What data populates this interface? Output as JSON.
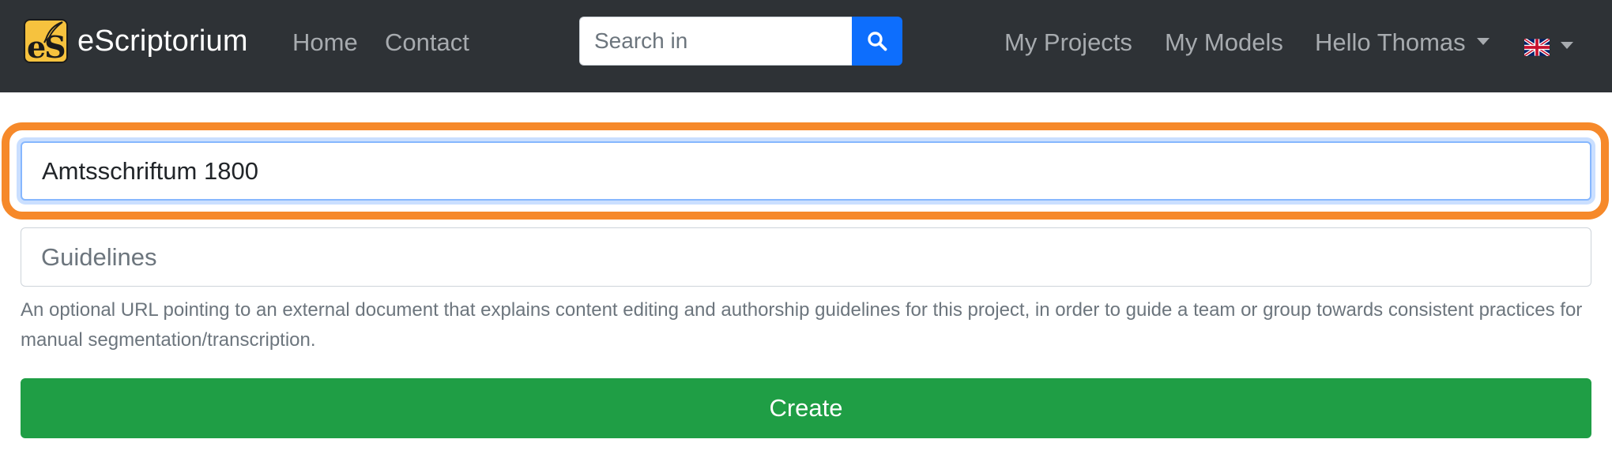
{
  "navbar": {
    "brand_logo_text": "eS",
    "brand_name": "eScriptorium",
    "links": {
      "home": "Home",
      "contact": "Contact",
      "my_projects": "My Projects",
      "my_models": "My Models",
      "user": "Hello Thomas"
    },
    "search": {
      "placeholder": "Search in",
      "value": "",
      "icon": "search-icon"
    },
    "language": {
      "flag_icon": "uk-flag-icon"
    },
    "colors": {
      "background": "#2e3236",
      "brand_text": "#ffffff",
      "link_text": "#a7abaf",
      "search_button": "#0d6efd",
      "logo_bg": "#f6c23e"
    }
  },
  "form": {
    "name_field": {
      "value": "Amtsschriftum 1800"
    },
    "guidelines_field": {
      "placeholder": "Guidelines",
      "value": ""
    },
    "help_text": "An optional URL pointing to an external document that explains content editing and authorship guidelines for this project, in order to guide a team or group towards consistent practices for manual segmentation/transcription.",
    "submit_label": "Create",
    "colors": {
      "highlight_ring": "#f6892a",
      "focus_border": "#86b7fe",
      "submit_bg": "#1f9e45",
      "help_text": "#6c757d"
    }
  }
}
